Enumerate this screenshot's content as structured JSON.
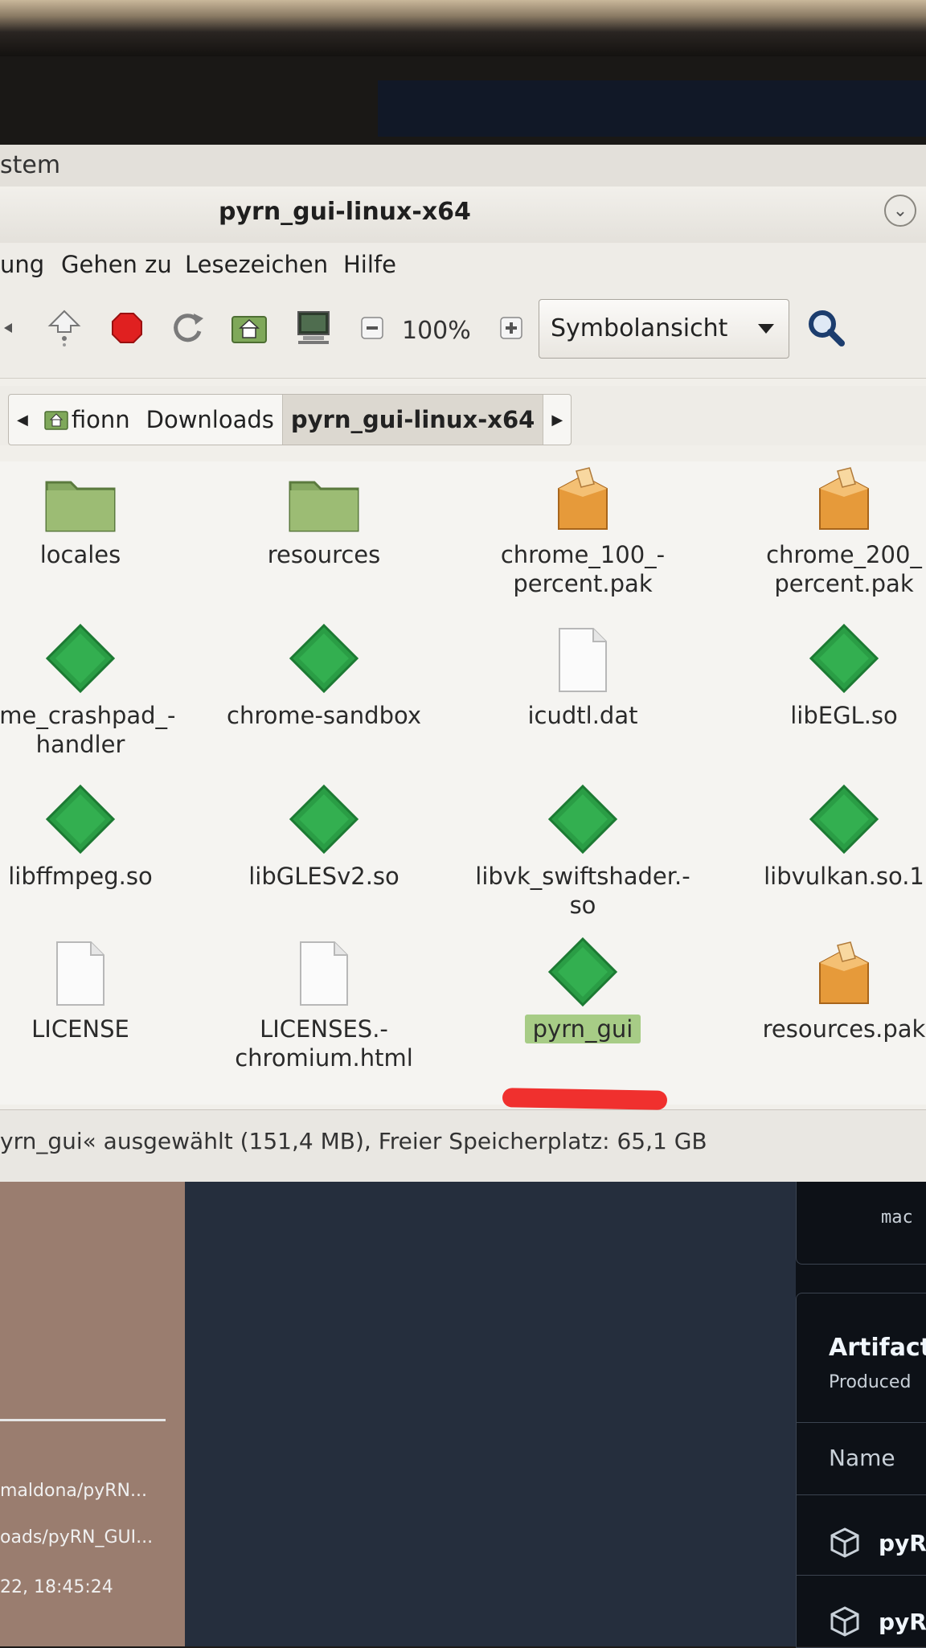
{
  "system_menu_label": "stem",
  "window_title": "pyrn_gui-linux-x64",
  "menu": [
    "ung",
    "Gehen zu",
    "Lesezeichen",
    "Hilfe"
  ],
  "toolbar": {
    "zoom_level": "100%",
    "view_mode": "Symbolansicht"
  },
  "breadcrumbs": [
    "fionn",
    "Downloads",
    "pyrn_gui-linux-x64"
  ],
  "files": [
    {
      "name": "locales",
      "icon": "folder-icon"
    },
    {
      "name": "resources",
      "icon": "folder-icon"
    },
    {
      "name": "chrome_100_-\npercent.pak",
      "icon": "package-icon"
    },
    {
      "name": "chrome_200_\npercent.pak",
      "icon": "package-icon"
    },
    {
      "name": "ome_crashpad_-\nhandler",
      "icon": "executable-icon"
    },
    {
      "name": "chrome-sandbox",
      "icon": "executable-icon"
    },
    {
      "name": "icudtl.dat",
      "icon": "document-icon"
    },
    {
      "name": "libEGL.so",
      "icon": "executable-icon"
    },
    {
      "name": "libffmpeg.so",
      "icon": "executable-icon"
    },
    {
      "name": "libGLESv2.so",
      "icon": "executable-icon"
    },
    {
      "name": "libvk_swiftshader.-\nso",
      "icon": "executable-icon"
    },
    {
      "name": "libvulkan.so.1",
      "icon": "executable-icon"
    },
    {
      "name": "LICENSE",
      "icon": "document-icon"
    },
    {
      "name": "LICENSES.-\nchromium.html",
      "icon": "document-icon"
    },
    {
      "name": "pyrn_gui",
      "icon": "executable-icon",
      "selected": true
    },
    {
      "name": "resources.pak",
      "icon": "package-icon"
    }
  ],
  "status_text": "yrn_gui« ausgewählt (151,4 MB), Freier Speicherplatz: 65,1 GB",
  "background": {
    "left_lines": [
      "maldona/pyRN...",
      "oads/pyRN_GUI...",
      "22, 18:45:24"
    ],
    "panel_mono": "mac",
    "artifacts_heading": "Artifact",
    "artifacts_sub": "Produced",
    "name_header": "Name",
    "artifact_rows": [
      "pyR",
      "pyR"
    ]
  },
  "colors": {
    "selection": "#a7cc86",
    "annotation": "#f0302e",
    "executable": "#2a9d45",
    "folder": "#8fb06a"
  }
}
